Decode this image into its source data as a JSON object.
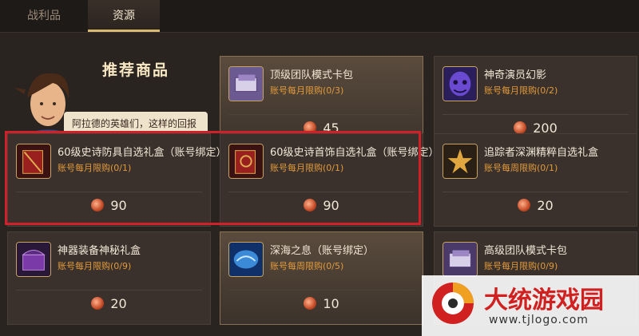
{
  "tabs": [
    {
      "label": "战利品"
    },
    {
      "label": "资源"
    }
  ],
  "recommend": {
    "banner": "推荐商品",
    "dialog": "阿拉德的英雄们，这样的回报还满意吗？"
  },
  "products": [
    {
      "name": "顶级团队模式卡包",
      "limit": "账号每月限购(0/3)",
      "price": "45",
      "icon": "card-pack-icon"
    },
    {
      "name": "神奇演员幻影",
      "limit": "账号每月限购(0/2)",
      "price": "200",
      "icon": "phantom-mask-icon"
    },
    {
      "name": "60级史诗防具自选礼盒（账号绑定）",
      "limit": "账号每月限购(0/1)",
      "price": "90",
      "icon": "armor-giftbox-icon"
    },
    {
      "name": "60级史诗首饰自选礼盒（账号绑定）",
      "limit": "账号每月限购(0/1)",
      "price": "90",
      "icon": "jewelry-giftbox-icon"
    },
    {
      "name": "追踪者深渊精粹自选礼盒",
      "limit": "账号每周限购(0/1)",
      "price": "20",
      "icon": "abyss-essence-icon"
    },
    {
      "name": "神器装备神秘礼盒",
      "limit": "账号每月限购(0/9)",
      "price": "20",
      "icon": "mystery-chest-icon"
    },
    {
      "name": "深海之息（账号绑定）",
      "limit": "账号每周限购(0/5)",
      "price": "10",
      "icon": "deep-sea-ticket-icon"
    },
    {
      "name": "高级团队模式卡包",
      "limit": "账号每月限购(0/9)",
      "price": "",
      "icon": "card-pack-icon"
    }
  ],
  "watermark": {
    "title": "大统游戏园",
    "url": "www.tjlogo.com"
  },
  "colors": {
    "background": "#2a2421",
    "card": "#3a312c",
    "limit_text": "#e29a3a",
    "highlight_border": "#d0202a",
    "tab_active_underline": "#d9b870"
  }
}
